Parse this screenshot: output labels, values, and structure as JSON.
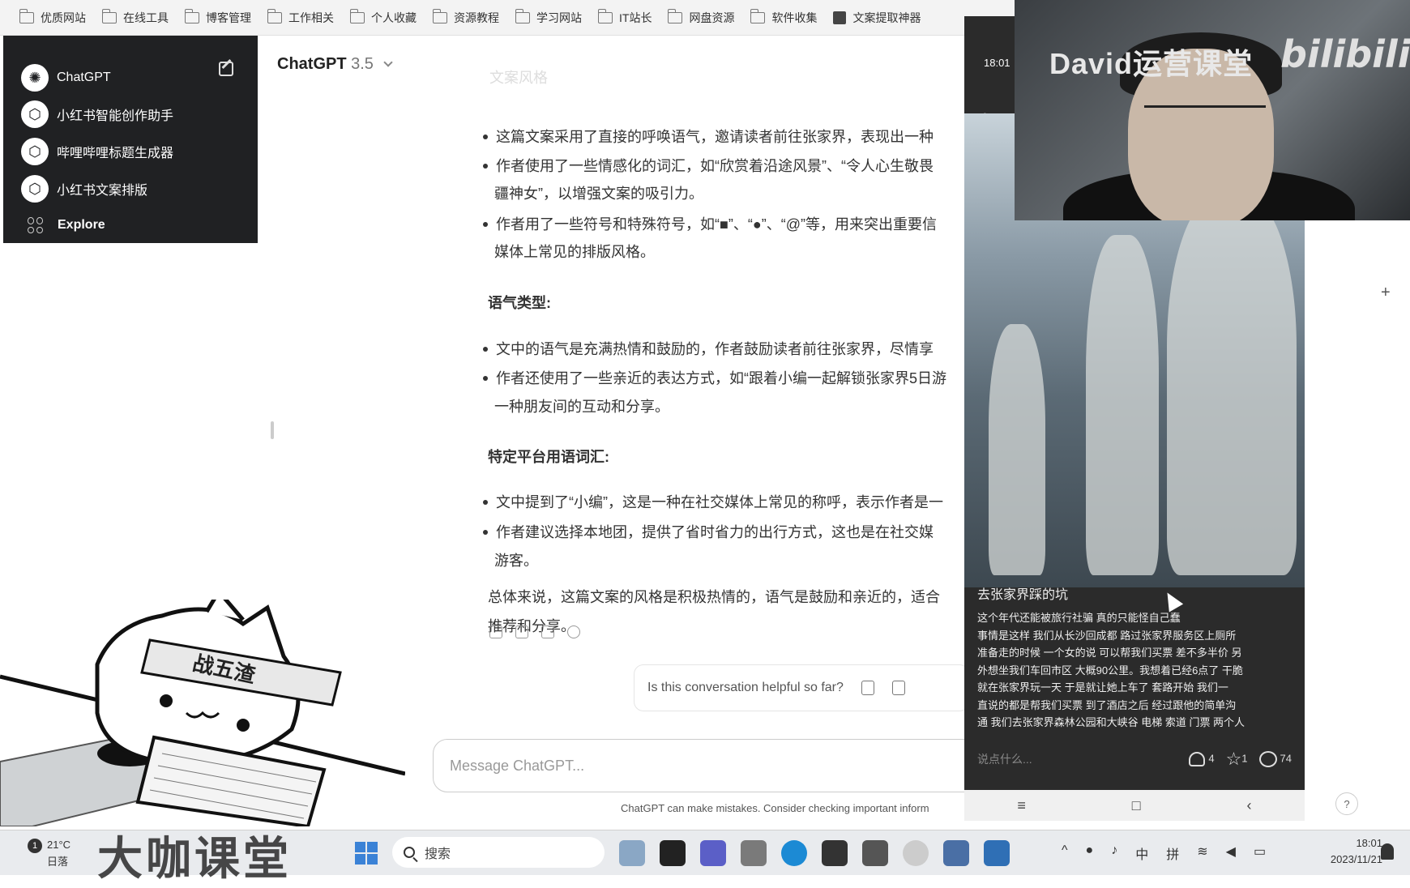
{
  "bookmarks": [
    {
      "label": "优质网站",
      "icon": "folder-icon"
    },
    {
      "label": "在线工具",
      "icon": "folder-icon"
    },
    {
      "label": "博客管理",
      "icon": "folder-icon"
    },
    {
      "label": "工作相关",
      "icon": "folder-icon"
    },
    {
      "label": "个人收藏",
      "icon": "folder-icon"
    },
    {
      "label": "资源教程",
      "icon": "folder-icon"
    },
    {
      "label": "学习网站",
      "icon": "folder-icon"
    },
    {
      "label": "IT站长",
      "icon": "folder-icon"
    },
    {
      "label": "网盘资源",
      "icon": "folder-icon"
    },
    {
      "label": "软件收集",
      "icon": "folder-icon"
    },
    {
      "label": "文案提取神器",
      "icon": "app-icon"
    }
  ],
  "sidebar": {
    "items": [
      {
        "label": "ChatGPT",
        "icon": "chatgpt-logo-icon"
      },
      {
        "label": "小红书智能创作助手",
        "icon": "gpt-cube-icon"
      },
      {
        "label": "哔哩哔哩标题生成器",
        "icon": "gpt-cube-icon"
      },
      {
        "label": "小红书文案排版",
        "icon": "gpt-cube-icon"
      },
      {
        "label": "Explore",
        "icon": "explore-grid-icon"
      }
    ]
  },
  "header": {
    "model": "ChatGPT",
    "version": "3.5"
  },
  "conversation": {
    "faded_heading": "文案风格",
    "style_bullets": [
      "这篇文案采用了直接的呼唤语气，邀请读者前往张家界，表现出一种",
      "作者使用了一些情感化的词汇，如“欣赏着沿途风景”、“令人心生敬畏",
      "疆神女”，以增强文案的吸引力。",
      "作者用了一些符号和特殊符号，如“■”、“●”、“@”等，用来突出重要信",
      "媒体上常见的排版风格。"
    ],
    "tone_heading": "语气类型",
    "tone_bullets": [
      "文中的语气是充满热情和鼓励的，作者鼓励读者前往张家界，尽情享",
      "作者还使用了一些亲近的表达方式，如“跟着小编一起解锁张家界5日游",
      "一种朋友间的互动和分享。"
    ],
    "platform_heading": "特定平台用语词汇",
    "platform_bullets": [
      "文中提到了“小编”，这是一种在社交媒体上常见的称呼，表示作者是一",
      "作者建议选择本地团，提供了省时省力的出行方式，这也是在社交媒",
      "游客。"
    ],
    "summary": [
      "总体来说，这篇文案的风格是积极热情的，语气是鼓励和亲近的，适合",
      "推荐和分享。"
    ]
  },
  "feedback": {
    "question": "Is this conversation helpful so far?"
  },
  "composer": {
    "placeholder": "Message ChatGPT...",
    "disclaimer": "ChatGPT can make mistakes. Consider checking important inform"
  },
  "sticker": {
    "headband": "战五渣"
  },
  "phone": {
    "status_time": "18:01",
    "post_title": "去张家界踩的坑",
    "post_lines": [
      "这个年代还能被旅行社骗  真的只能怪自己蠢",
      "事情是这样 我们从长沙回成都 路过张家界服务区上厕所",
      "准备走的时候 一个女的说 可以帮我们买票  差不多半价 另",
      "外想坐我们车回市区 大概90公里。我想着已经6点了 干脆",
      "就在张家界玩一天   于是就让她上车了  套路开始 我们一",
      "直说的都是帮我们买票  到了酒店之后 经过跟他的简单沟",
      "通 我们去张家界森林公园和大峡谷 电梯 索道 门票 两个人"
    ],
    "comment_placeholder": "说点什么...",
    "likes": "4",
    "stars": "1",
    "comments": "74"
  },
  "watermark": {
    "channel": "David运营课堂",
    "site": "bilibili"
  },
  "help": "?",
  "taskbar": {
    "weather_temp": "21°C",
    "weather_desc": "日落",
    "weather_badge": "1",
    "brand": "大咖课堂",
    "search_label": "搜索",
    "ime": "中",
    "ime2": "拼",
    "time": "18:01",
    "date": "2023/11/21"
  }
}
